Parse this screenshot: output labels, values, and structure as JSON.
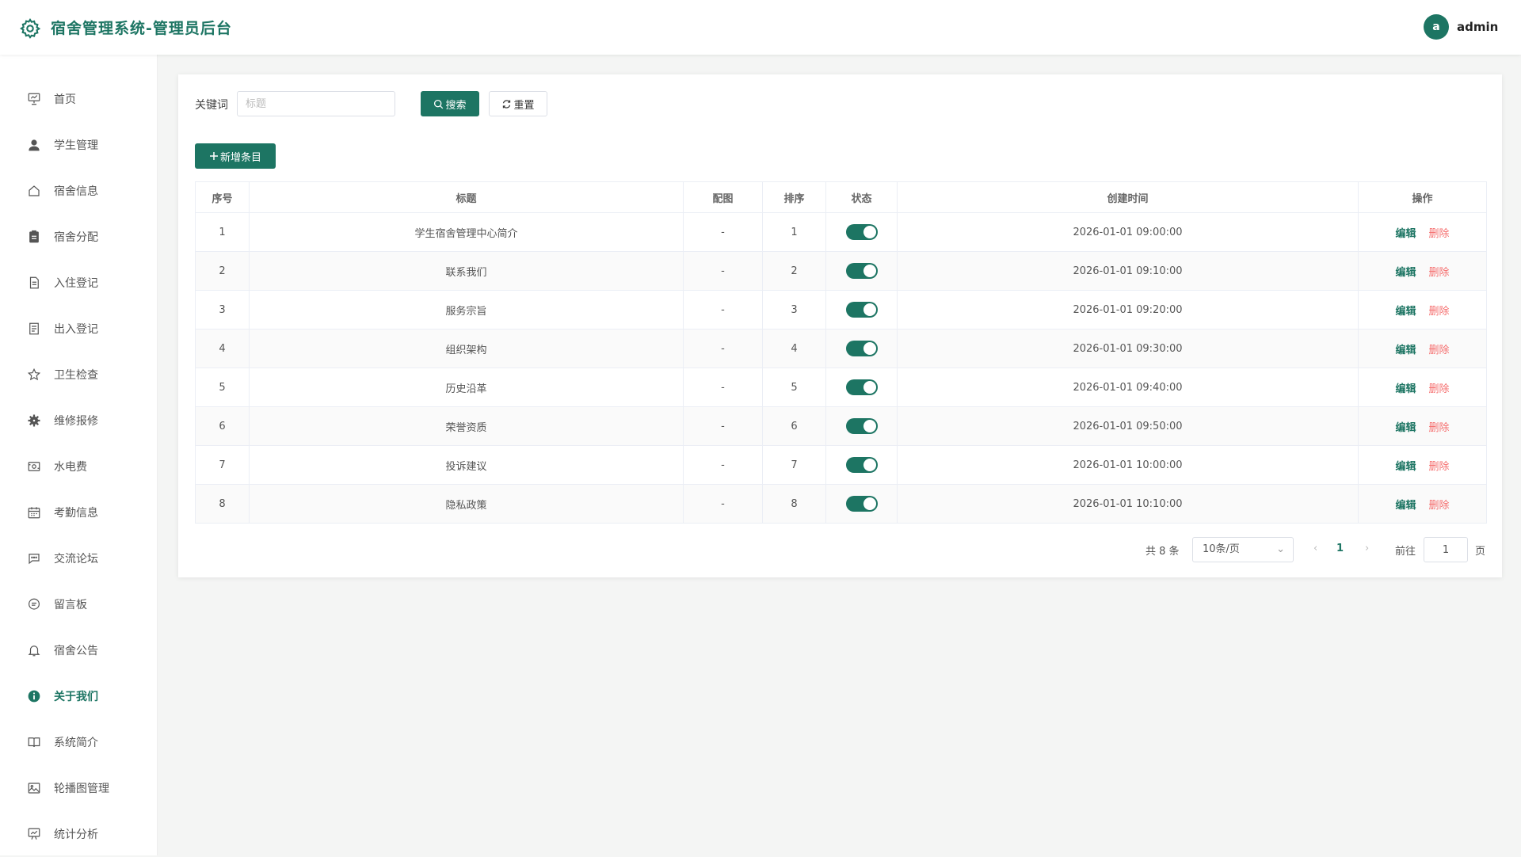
{
  "header": {
    "title": "宿舍管理系统-管理员后台",
    "avatar_letter": "a",
    "username": "admin"
  },
  "sidebar": {
    "items": [
      {
        "label": "首页",
        "icon": "presentation-icon"
      },
      {
        "label": "学生管理",
        "icon": "user-icon"
      },
      {
        "label": "宿舍信息",
        "icon": "home-icon"
      },
      {
        "label": "宿舍分配",
        "icon": "clipboard-icon"
      },
      {
        "label": "入住登记",
        "icon": "document-icon"
      },
      {
        "label": "出入登记",
        "icon": "list-document-icon"
      },
      {
        "label": "卫生检查",
        "icon": "star-icon"
      },
      {
        "label": "维修报修",
        "icon": "gear-icon"
      },
      {
        "label": "水电费",
        "icon": "money-icon"
      },
      {
        "label": "考勤信息",
        "icon": "calendar-icon"
      },
      {
        "label": "交流论坛",
        "icon": "chat-dots-icon"
      },
      {
        "label": "留言板",
        "icon": "chat-lines-icon"
      },
      {
        "label": "宿舍公告",
        "icon": "bell-icon"
      },
      {
        "label": "关于我们",
        "icon": "info-icon",
        "active": true
      },
      {
        "label": "系统简介",
        "icon": "book-icon"
      },
      {
        "label": "轮播图管理",
        "icon": "picture-icon"
      },
      {
        "label": "统计分析",
        "icon": "data-board-icon"
      }
    ]
  },
  "search": {
    "label": "关键词",
    "placeholder": "标题",
    "value": "",
    "search_button": "搜索",
    "reset_button": "重置"
  },
  "add_button": "新增条目",
  "table": {
    "headers": [
      "序号",
      "标题",
      "配图",
      "排序",
      "状态",
      "创建时间",
      "操作"
    ],
    "rows": [
      {
        "index": "1",
        "title": "学生宿舍管理中心简介",
        "image": "-",
        "sort": "1",
        "status": true,
        "created": "2026-01-01 09:00:00"
      },
      {
        "index": "2",
        "title": "联系我们",
        "image": "-",
        "sort": "2",
        "status": true,
        "created": "2026-01-01 09:10:00"
      },
      {
        "index": "3",
        "title": "服务宗旨",
        "image": "-",
        "sort": "3",
        "status": true,
        "created": "2026-01-01 09:20:00"
      },
      {
        "index": "4",
        "title": "组织架构",
        "image": "-",
        "sort": "4",
        "status": true,
        "created": "2026-01-01 09:30:00"
      },
      {
        "index": "5",
        "title": "历史沿革",
        "image": "-",
        "sort": "5",
        "status": true,
        "created": "2026-01-01 09:40:00"
      },
      {
        "index": "6",
        "title": "荣誉资质",
        "image": "-",
        "sort": "6",
        "status": true,
        "created": "2026-01-01 09:50:00"
      },
      {
        "index": "7",
        "title": "投诉建议",
        "image": "-",
        "sort": "7",
        "status": true,
        "created": "2026-01-01 10:00:00"
      },
      {
        "index": "8",
        "title": "隐私政策",
        "image": "-",
        "sort": "8",
        "status": true,
        "created": "2026-01-01 10:10:00"
      }
    ],
    "edit_label": "编辑",
    "delete_label": "删除"
  },
  "pagination": {
    "total_text": "共 8 条",
    "page_size": "10条/页",
    "current_page": "1",
    "goto_label": "前往",
    "goto_value": "1",
    "page_suffix": "页"
  },
  "colors": {
    "accent": "#1d7563",
    "danger": "#f56c6c",
    "background": "#f4f5f4"
  }
}
